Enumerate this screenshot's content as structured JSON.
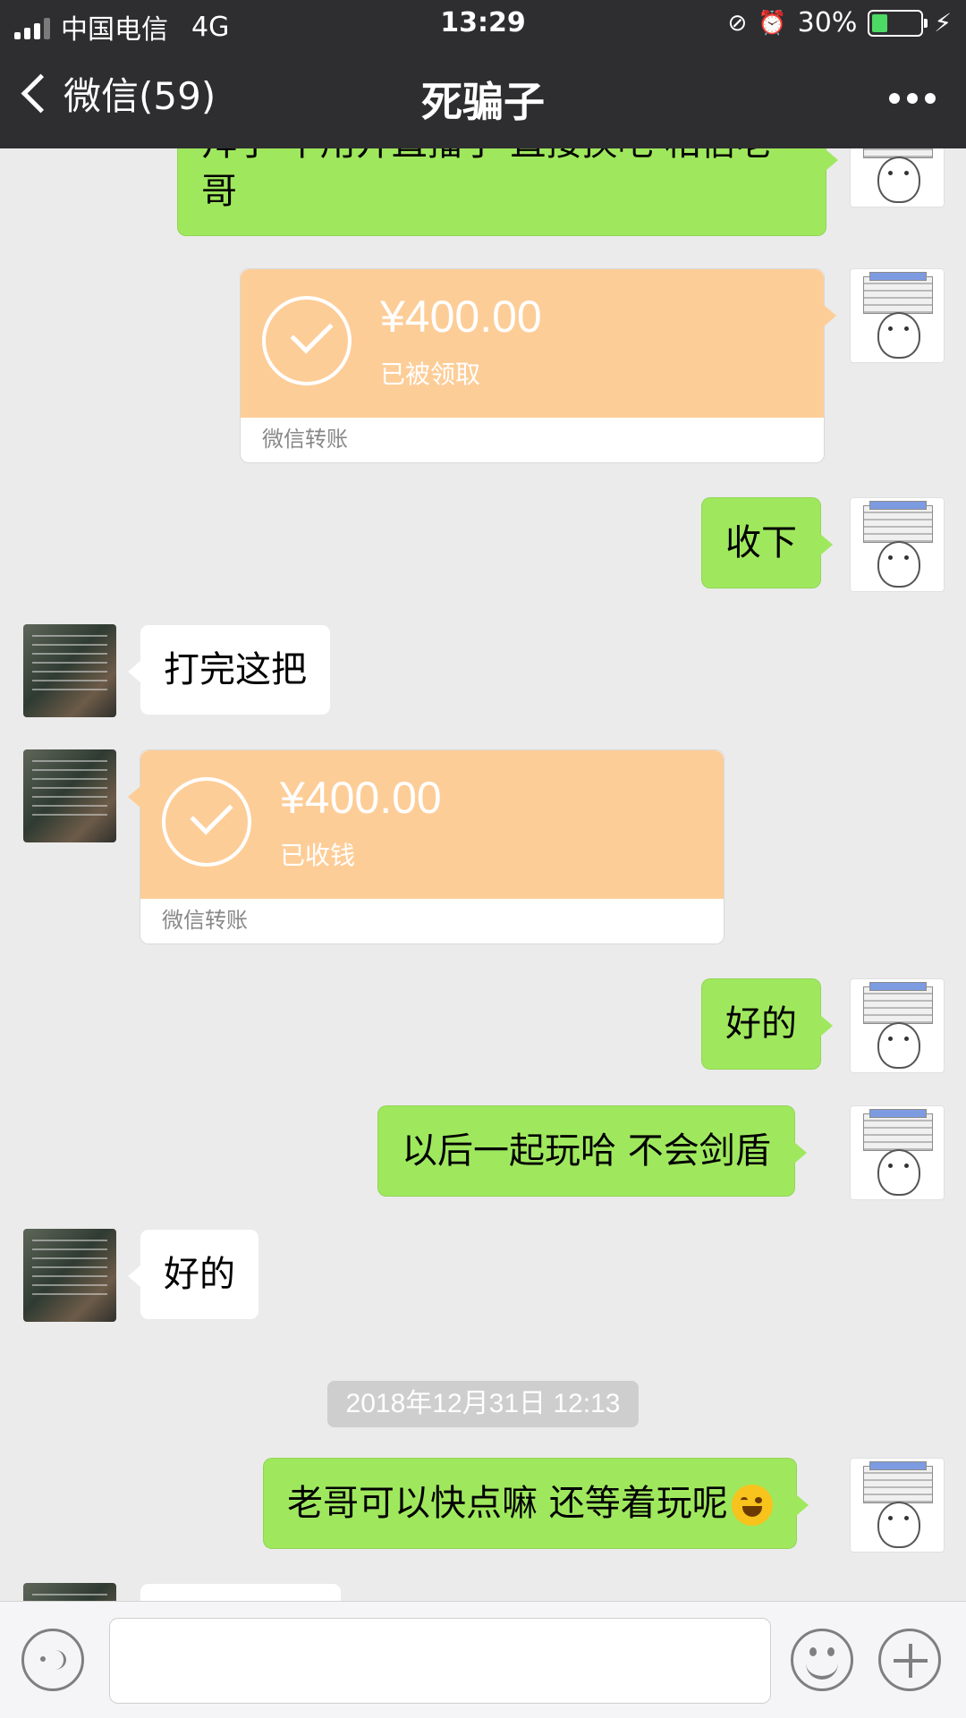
{
  "status_bar": {
    "carrier": "中国电信",
    "network": "4G",
    "time": "13:29",
    "battery": "30%",
    "battery_level": 0.3
  },
  "nav": {
    "back_label": "微信(59)",
    "title": "死骗子"
  },
  "messages": {
    "m1": "拜了 不用开直播了 直接换吧 相信老哥",
    "t1_amount": "¥400.00",
    "t1_status": "已被领取",
    "t1_footer": "微信转账",
    "m2": "收下",
    "m3": "打完这把",
    "t2_amount": "¥400.00",
    "t2_status": "已收钱",
    "t2_footer": "微信转账",
    "m4": "好的",
    "m5": "以后一起玩哈 不会剑盾",
    "m6": "好的",
    "timestamp": "2018年12月31日 12:13",
    "m7": "老哥可以快点嘛 还等着玩呢"
  },
  "colors": {
    "header_bg": "#2e2e30",
    "chat_bg": "#ebebeb",
    "my_bubble": "#9fe85e",
    "transfer_card": "#fdcd98"
  },
  "icons": {
    "back": "chevron-left-icon",
    "more": "more-dots-icon",
    "voice": "voice-icon",
    "emoji": "emoji-icon",
    "plus": "plus-icon"
  }
}
